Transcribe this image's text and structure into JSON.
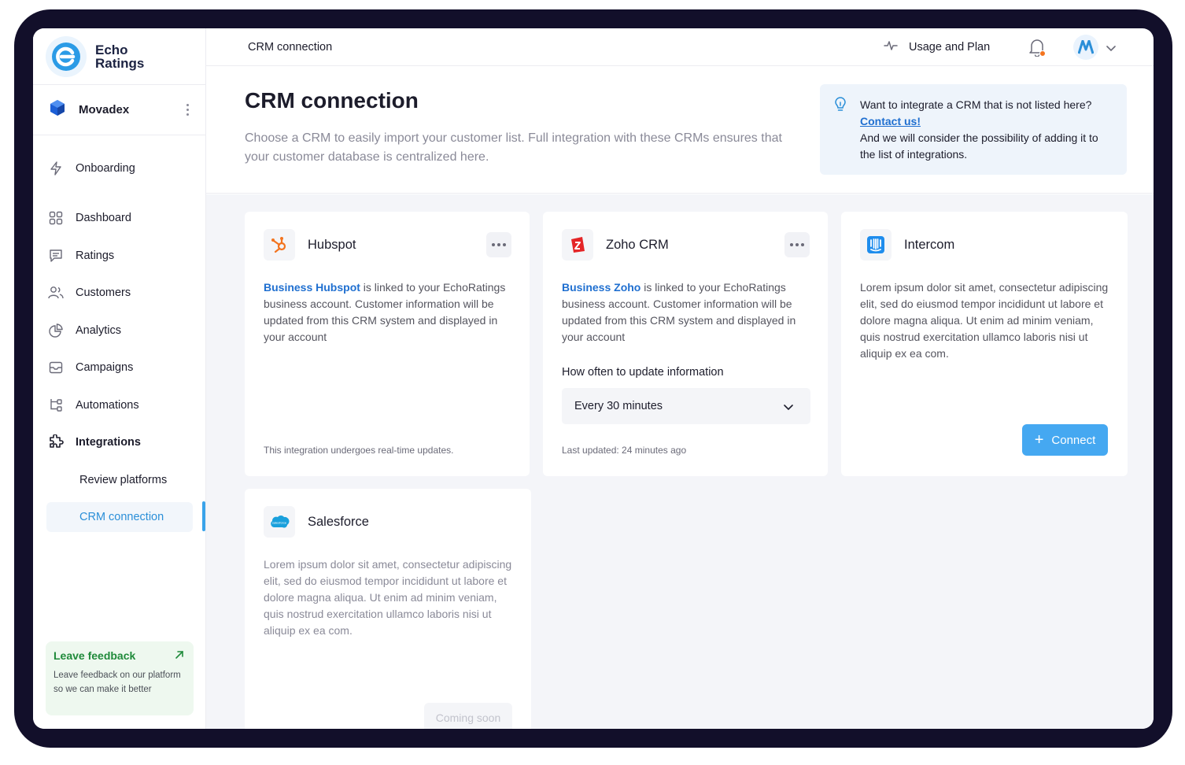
{
  "app": {
    "brand_line1": "Echo",
    "brand_line2": "Ratings"
  },
  "workspace": {
    "name": "Movadex"
  },
  "sidebar": {
    "items": [
      {
        "label": "Onboarding",
        "icon": "bolt-icon"
      },
      {
        "label": "Dashboard",
        "icon": "grid-icon"
      },
      {
        "label": "Ratings",
        "icon": "message-icon"
      },
      {
        "label": "Customers",
        "icon": "users-icon"
      },
      {
        "label": "Analytics",
        "icon": "pie-chart-icon"
      },
      {
        "label": "Campaigns",
        "icon": "mail-icon"
      },
      {
        "label": "Automations",
        "icon": "flow-icon"
      },
      {
        "label": "Integrations",
        "icon": "puzzle-icon"
      }
    ],
    "subitems": [
      {
        "label": "Review platforms",
        "active": false
      },
      {
        "label": "CRM connection",
        "active": true
      }
    ],
    "feedback": {
      "title": "Leave feedback",
      "text": "Leave feedback on our platform so we can make it better"
    }
  },
  "topbar": {
    "title": "CRM connection",
    "usage_label": "Usage and Plan"
  },
  "header": {
    "title": "CRM connection",
    "description": "Choose a CRM to easily import your customer list. Full integration with these CRMs ensures that your customer database is centralized here.",
    "info_line1": "Want to integrate a CRM that is not listed here?",
    "info_link": "Contact us!",
    "info_line2": "And we will consider the possibility of adding it to the list of integrations."
  },
  "cards": {
    "hubspot": {
      "name": "Hubspot",
      "link": "Business Hubspot",
      "text": " is linked to your EchoRatings business account. Customer information will be updated from this CRM system and displayed in your account",
      "footer": "This integration undergoes real-time updates."
    },
    "zoho": {
      "name": "Zoho CRM",
      "link": "Business Zoho",
      "text": " is linked to your EchoRatings business account. Customer information will be updated from this CRM system and displayed in your account",
      "select_label": "How often to update information",
      "select_value": "Every 30 minutes",
      "footer": "Last updated: 24 minutes ago"
    },
    "intercom": {
      "name": "Intercom",
      "text": "Lorem ipsum dolor sit amet, consectetur adipiscing elit, sed do eiusmod tempor incididunt ut labore et dolore magna aliqua. Ut enim ad minim veniam, quis nostrud exercitation ullamco laboris nisi ut aliquip ex ea com.",
      "button": "Connect"
    },
    "salesforce": {
      "name": "Salesforce",
      "logo_text": "salesforce",
      "text": "Lorem ipsum dolor sit amet, consectetur adipiscing elit, sed do eiusmod tempor incididunt ut labore et dolore magna aliqua. Ut enim ad minim veniam, quis nostrud exercitation ullamco laboris nisi ut aliquip ex ea com.",
      "button": "Coming soon"
    }
  },
  "colors": {
    "accent": "#3aa3ea",
    "link": "#1f6fd0",
    "feedback": "#1f8a3a",
    "frame": "#120f2a"
  }
}
